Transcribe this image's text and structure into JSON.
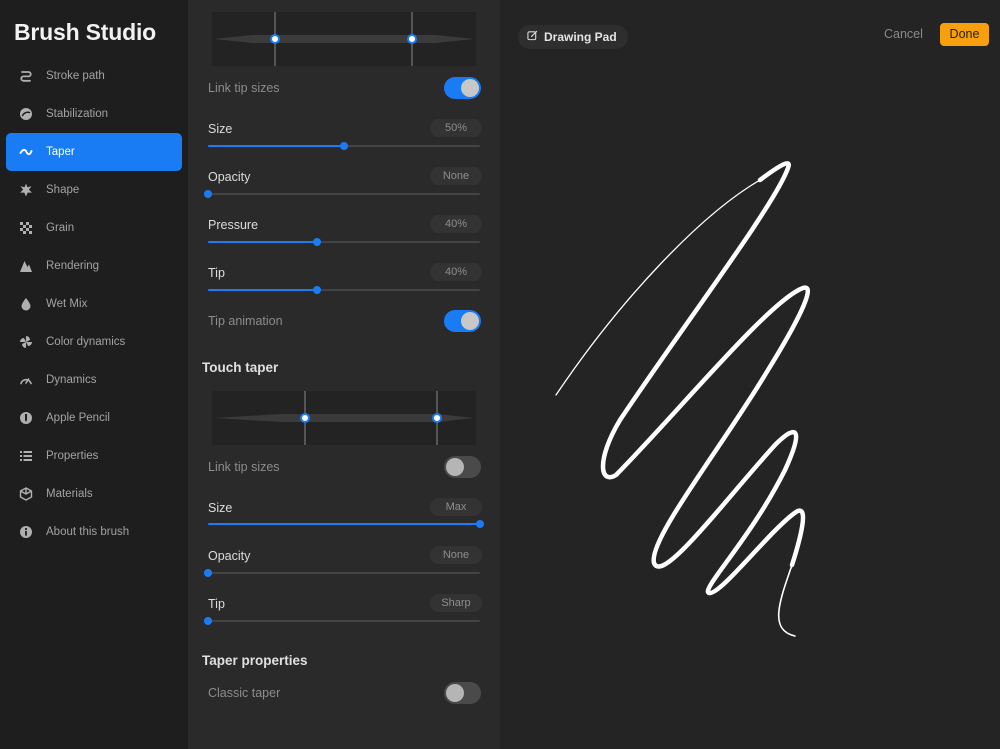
{
  "app": {
    "title": "Brush Studio"
  },
  "sidebar": {
    "items": [
      {
        "label": "Stroke path",
        "icon": "stroke-path-icon"
      },
      {
        "label": "Stabilization",
        "icon": "stabilization-icon"
      },
      {
        "label": "Taper",
        "icon": "taper-icon",
        "active": true
      },
      {
        "label": "Shape",
        "icon": "shape-icon"
      },
      {
        "label": "Grain",
        "icon": "grain-icon"
      },
      {
        "label": "Rendering",
        "icon": "rendering-icon"
      },
      {
        "label": "Wet Mix",
        "icon": "wet-mix-icon"
      },
      {
        "label": "Color dynamics",
        "icon": "color-dynamics-icon"
      },
      {
        "label": "Dynamics",
        "icon": "dynamics-icon"
      },
      {
        "label": "Apple Pencil",
        "icon": "apple-pencil-icon"
      },
      {
        "label": "Properties",
        "icon": "properties-icon"
      },
      {
        "label": "Materials",
        "icon": "materials-icon"
      },
      {
        "label": "About this brush",
        "icon": "about-icon"
      }
    ]
  },
  "pressure_taper": {
    "link_tip_sizes": {
      "label": "Link tip sizes",
      "on": true
    },
    "size": {
      "label": "Size",
      "value": "50%",
      "level": 0.5
    },
    "opacity": {
      "label": "Opacity",
      "value": "None",
      "level": 0.0
    },
    "pressure": {
      "label": "Pressure",
      "value": "40%",
      "level": 0.4
    },
    "tip": {
      "label": "Tip",
      "value": "40%",
      "level": 0.4
    },
    "tip_animation": {
      "label": "Tip animation",
      "on": true
    }
  },
  "touch_taper": {
    "title": "Touch taper",
    "link_tip_sizes": {
      "label": "Link tip sizes",
      "on": false
    },
    "size": {
      "label": "Size",
      "value": "Max",
      "level": 1.0
    },
    "opacity": {
      "label": "Opacity",
      "value": "None",
      "level": 0.0
    },
    "tip": {
      "label": "Tip",
      "value": "Sharp",
      "level": 0.0
    }
  },
  "taper_properties": {
    "title": "Taper properties",
    "classic_taper": {
      "label": "Classic taper",
      "on": false
    }
  },
  "drawing_pad": {
    "label": "Drawing Pad",
    "cancel_label": "Cancel",
    "done_label": "Done"
  },
  "colors": {
    "accent": "#1a7cf5",
    "done_button": "#f5a00c",
    "stroke": "#ffffff"
  }
}
